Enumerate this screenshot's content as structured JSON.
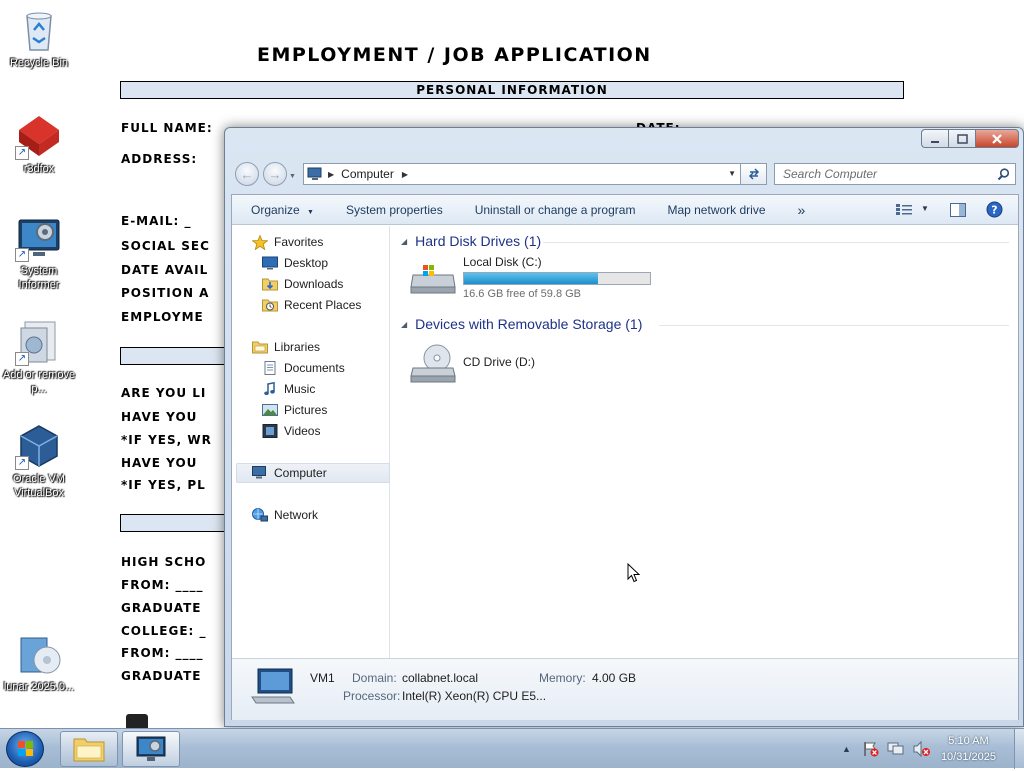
{
  "wallpaper": {
    "title": "EMPLOYMENT / JOB APPLICATION",
    "personal_info_bar": "PERSONAL INFORMATION",
    "fields": [
      "FULL NAME:",
      "ADDRESS:",
      "E-MAIL: _",
      "SOCIAL SEC",
      "DATE AVAIL",
      "POSITION A",
      "EMPLOYME",
      "ARE YOU LI",
      "HAVE YOU",
      "*IF YES, WR",
      "HAVE YOU",
      "*IF YES, PL",
      "HIGH SCHO",
      "FROM: ____",
      "GRADUATE",
      "COLLEGE: _",
      "FROM: ____",
      "GRADUATE"
    ],
    "date_label": "DATE:"
  },
  "desktop_icons": [
    {
      "label": "Recycle Bin",
      "icon": "recycle-bin-icon"
    },
    {
      "label": "r3dfox",
      "icon": "r3dfox-icon"
    },
    {
      "label": "System Informer",
      "icon": "system-informer-icon"
    },
    {
      "label": "Add or remove p...",
      "icon": "add-remove-programs-icon"
    },
    {
      "label": "Oracle VM VirtualBox",
      "icon": "virtualbox-icon"
    },
    {
      "label": "lunar 2025.0...",
      "icon": "installer-icon"
    }
  ],
  "explorer": {
    "address": {
      "crumb": "Computer",
      "search_placeholder": "Search Computer"
    },
    "commands": {
      "organize": "Organize",
      "system_properties": "System properties",
      "uninstall": "Uninstall or change a program",
      "map_drive": "Map network drive",
      "more": "»"
    },
    "nav": {
      "favorites": "Favorites",
      "desktop": "Desktop",
      "downloads": "Downloads",
      "recent": "Recent Places",
      "libraries": "Libraries",
      "documents": "Documents",
      "music": "Music",
      "pictures": "Pictures",
      "videos": "Videos",
      "computer": "Computer",
      "network": "Network"
    },
    "groups": {
      "hdd_header": "Hard Disk Drives (1)",
      "removable_header": "Devices with Removable Storage (1)"
    },
    "drives": {
      "c_name": "Local Disk (C:)",
      "c_free": "16.6 GB free of 59.8 GB",
      "c_used_fraction": 0.722,
      "d_name": "CD Drive (D:)"
    },
    "details": {
      "name": "VM1",
      "domain_label": "Domain:",
      "domain_value": "collabnet.local",
      "memory_label": "Memory:",
      "memory_value": "4.00 GB",
      "processor_label": "Processor:",
      "processor_value": "Intel(R) Xeon(R) CPU E5..."
    }
  },
  "taskbar": {
    "time": "5:10 AM",
    "date": "10/31/2025"
  },
  "colors": {
    "accent": "#1e3287",
    "drive_bar": "#26a0da",
    "taskbar": "#a9bed6"
  }
}
